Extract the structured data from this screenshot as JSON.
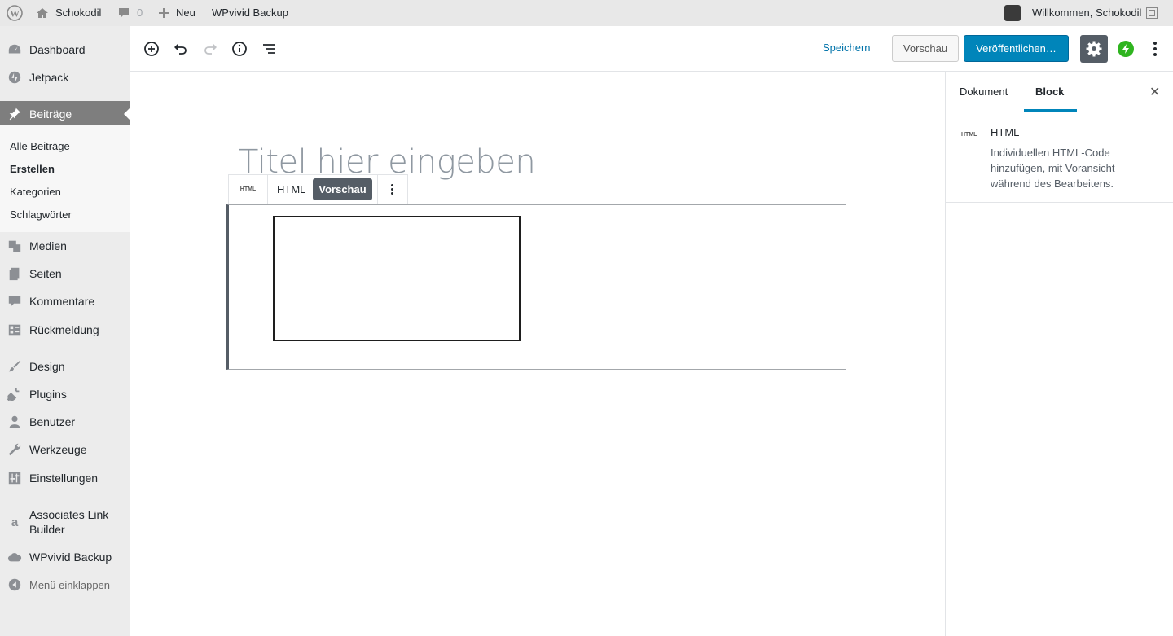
{
  "adminbar": {
    "site_name": "Schokodil",
    "comments_count": "0",
    "new_label": "Neu",
    "plugin_label": "WPvivid Backup",
    "welcome": "Willkommen, Schokodil"
  },
  "sidebar": {
    "items": [
      {
        "label": "Dashboard",
        "icon": "dashboard-icon"
      },
      {
        "label": "Jetpack",
        "icon": "jetpack-icon"
      },
      {
        "label": "Beiträge",
        "icon": "pin-icon"
      },
      {
        "label": "Medien",
        "icon": "media-icon"
      },
      {
        "label": "Seiten",
        "icon": "pages-icon"
      },
      {
        "label": "Kommentare",
        "icon": "comments-icon"
      },
      {
        "label": "Rückmeldung",
        "icon": "feedback-icon"
      },
      {
        "label": "Design",
        "icon": "brush-icon"
      },
      {
        "label": "Plugins",
        "icon": "plugin-icon"
      },
      {
        "label": "Benutzer",
        "icon": "user-icon"
      },
      {
        "label": "Werkzeuge",
        "icon": "wrench-icon"
      },
      {
        "label": "Einstellungen",
        "icon": "settings-icon"
      },
      {
        "label": "Associates Link Builder",
        "icon": "amazon-icon"
      },
      {
        "label": "WPvivid Backup",
        "icon": "cloud-icon"
      },
      {
        "label": "Menü einklappen",
        "icon": "collapse-icon"
      }
    ],
    "submenu": [
      "Alle Beiträge",
      "Erstellen",
      "Kategorien",
      "Schlagwörter"
    ]
  },
  "header": {
    "save_label": "Speichern",
    "preview_label": "Vorschau",
    "publish_label": "Veröffentlichen…"
  },
  "editor": {
    "title_placeholder": "Titel hier eingeben",
    "block_icon_text": "HTML",
    "tab_html": "HTML",
    "tab_preview": "Vorschau"
  },
  "settings": {
    "tab_document": "Dokument",
    "tab_block": "Block",
    "block_icon_text": "HTML",
    "block_title": "HTML",
    "block_description": "Individuellen HTML-Code hinzufügen, mit Voransicht während des Bearbeitens."
  }
}
